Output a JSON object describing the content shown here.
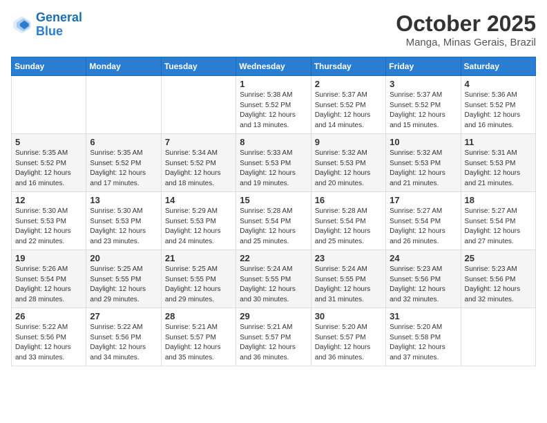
{
  "header": {
    "logo_line1": "General",
    "logo_line2": "Blue",
    "month": "October 2025",
    "location": "Manga, Minas Gerais, Brazil"
  },
  "days_of_week": [
    "Sunday",
    "Monday",
    "Tuesday",
    "Wednesday",
    "Thursday",
    "Friday",
    "Saturday"
  ],
  "weeks": [
    [
      {
        "day": "",
        "info": ""
      },
      {
        "day": "",
        "info": ""
      },
      {
        "day": "",
        "info": ""
      },
      {
        "day": "1",
        "info": "Sunrise: 5:38 AM\nSunset: 5:52 PM\nDaylight: 12 hours\nand 13 minutes."
      },
      {
        "day": "2",
        "info": "Sunrise: 5:37 AM\nSunset: 5:52 PM\nDaylight: 12 hours\nand 14 minutes."
      },
      {
        "day": "3",
        "info": "Sunrise: 5:37 AM\nSunset: 5:52 PM\nDaylight: 12 hours\nand 15 minutes."
      },
      {
        "day": "4",
        "info": "Sunrise: 5:36 AM\nSunset: 5:52 PM\nDaylight: 12 hours\nand 16 minutes."
      }
    ],
    [
      {
        "day": "5",
        "info": "Sunrise: 5:35 AM\nSunset: 5:52 PM\nDaylight: 12 hours\nand 16 minutes."
      },
      {
        "day": "6",
        "info": "Sunrise: 5:35 AM\nSunset: 5:52 PM\nDaylight: 12 hours\nand 17 minutes."
      },
      {
        "day": "7",
        "info": "Sunrise: 5:34 AM\nSunset: 5:52 PM\nDaylight: 12 hours\nand 18 minutes."
      },
      {
        "day": "8",
        "info": "Sunrise: 5:33 AM\nSunset: 5:53 PM\nDaylight: 12 hours\nand 19 minutes."
      },
      {
        "day": "9",
        "info": "Sunrise: 5:32 AM\nSunset: 5:53 PM\nDaylight: 12 hours\nand 20 minutes."
      },
      {
        "day": "10",
        "info": "Sunrise: 5:32 AM\nSunset: 5:53 PM\nDaylight: 12 hours\nand 21 minutes."
      },
      {
        "day": "11",
        "info": "Sunrise: 5:31 AM\nSunset: 5:53 PM\nDaylight: 12 hours\nand 21 minutes."
      }
    ],
    [
      {
        "day": "12",
        "info": "Sunrise: 5:30 AM\nSunset: 5:53 PM\nDaylight: 12 hours\nand 22 minutes."
      },
      {
        "day": "13",
        "info": "Sunrise: 5:30 AM\nSunset: 5:53 PM\nDaylight: 12 hours\nand 23 minutes."
      },
      {
        "day": "14",
        "info": "Sunrise: 5:29 AM\nSunset: 5:53 PM\nDaylight: 12 hours\nand 24 minutes."
      },
      {
        "day": "15",
        "info": "Sunrise: 5:28 AM\nSunset: 5:54 PM\nDaylight: 12 hours\nand 25 minutes."
      },
      {
        "day": "16",
        "info": "Sunrise: 5:28 AM\nSunset: 5:54 PM\nDaylight: 12 hours\nand 25 minutes."
      },
      {
        "day": "17",
        "info": "Sunrise: 5:27 AM\nSunset: 5:54 PM\nDaylight: 12 hours\nand 26 minutes."
      },
      {
        "day": "18",
        "info": "Sunrise: 5:27 AM\nSunset: 5:54 PM\nDaylight: 12 hours\nand 27 minutes."
      }
    ],
    [
      {
        "day": "19",
        "info": "Sunrise: 5:26 AM\nSunset: 5:54 PM\nDaylight: 12 hours\nand 28 minutes."
      },
      {
        "day": "20",
        "info": "Sunrise: 5:25 AM\nSunset: 5:55 PM\nDaylight: 12 hours\nand 29 minutes."
      },
      {
        "day": "21",
        "info": "Sunrise: 5:25 AM\nSunset: 5:55 PM\nDaylight: 12 hours\nand 29 minutes."
      },
      {
        "day": "22",
        "info": "Sunrise: 5:24 AM\nSunset: 5:55 PM\nDaylight: 12 hours\nand 30 minutes."
      },
      {
        "day": "23",
        "info": "Sunrise: 5:24 AM\nSunset: 5:55 PM\nDaylight: 12 hours\nand 31 minutes."
      },
      {
        "day": "24",
        "info": "Sunrise: 5:23 AM\nSunset: 5:56 PM\nDaylight: 12 hours\nand 32 minutes."
      },
      {
        "day": "25",
        "info": "Sunrise: 5:23 AM\nSunset: 5:56 PM\nDaylight: 12 hours\nand 32 minutes."
      }
    ],
    [
      {
        "day": "26",
        "info": "Sunrise: 5:22 AM\nSunset: 5:56 PM\nDaylight: 12 hours\nand 33 minutes."
      },
      {
        "day": "27",
        "info": "Sunrise: 5:22 AM\nSunset: 5:56 PM\nDaylight: 12 hours\nand 34 minutes."
      },
      {
        "day": "28",
        "info": "Sunrise: 5:21 AM\nSunset: 5:57 PM\nDaylight: 12 hours\nand 35 minutes."
      },
      {
        "day": "29",
        "info": "Sunrise: 5:21 AM\nSunset: 5:57 PM\nDaylight: 12 hours\nand 36 minutes."
      },
      {
        "day": "30",
        "info": "Sunrise: 5:20 AM\nSunset: 5:57 PM\nDaylight: 12 hours\nand 36 minutes."
      },
      {
        "day": "31",
        "info": "Sunrise: 5:20 AM\nSunset: 5:58 PM\nDaylight: 12 hours\nand 37 minutes."
      },
      {
        "day": "",
        "info": ""
      }
    ]
  ]
}
